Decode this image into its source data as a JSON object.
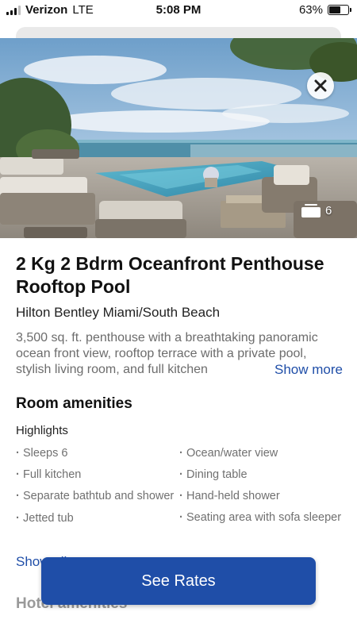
{
  "status_bar": {
    "carrier": "Verizon",
    "network": "LTE",
    "time": "5:08 PM",
    "battery": "63%",
    "battery_level": 0.63
  },
  "hero": {
    "photo_count": "6",
    "close_icon": "close-icon",
    "gallery_icon": "photo-stack-icon"
  },
  "room": {
    "title": "2 Kg 2 Bdrm Oceanfront Penthouse Rooftop Pool",
    "hotel": "Hilton Bentley Miami/South Beach",
    "description": "3,500 sq. ft. penthouse with a breathtaking panoramic ocean front view, rooftop terrace with a private pool, stylish living room, and full kitchen",
    "show_more": "Show more"
  },
  "amenities": {
    "title": "Room amenities",
    "subtitle": "Highlights",
    "left": [
      "Sleeps 6",
      "Full kitchen",
      "Separate bathtub and shower",
      "Jetted tub"
    ],
    "right": [
      "Ocean/water view",
      "Dining table",
      "Hand-held shower",
      "Seating area with sofa sleeper"
    ],
    "show_all": "Show all"
  },
  "hotel_amenities": {
    "title": "Hotel amenities"
  },
  "cta": {
    "label": "See Rates"
  },
  "colors": {
    "accent": "#1f4ea8"
  }
}
